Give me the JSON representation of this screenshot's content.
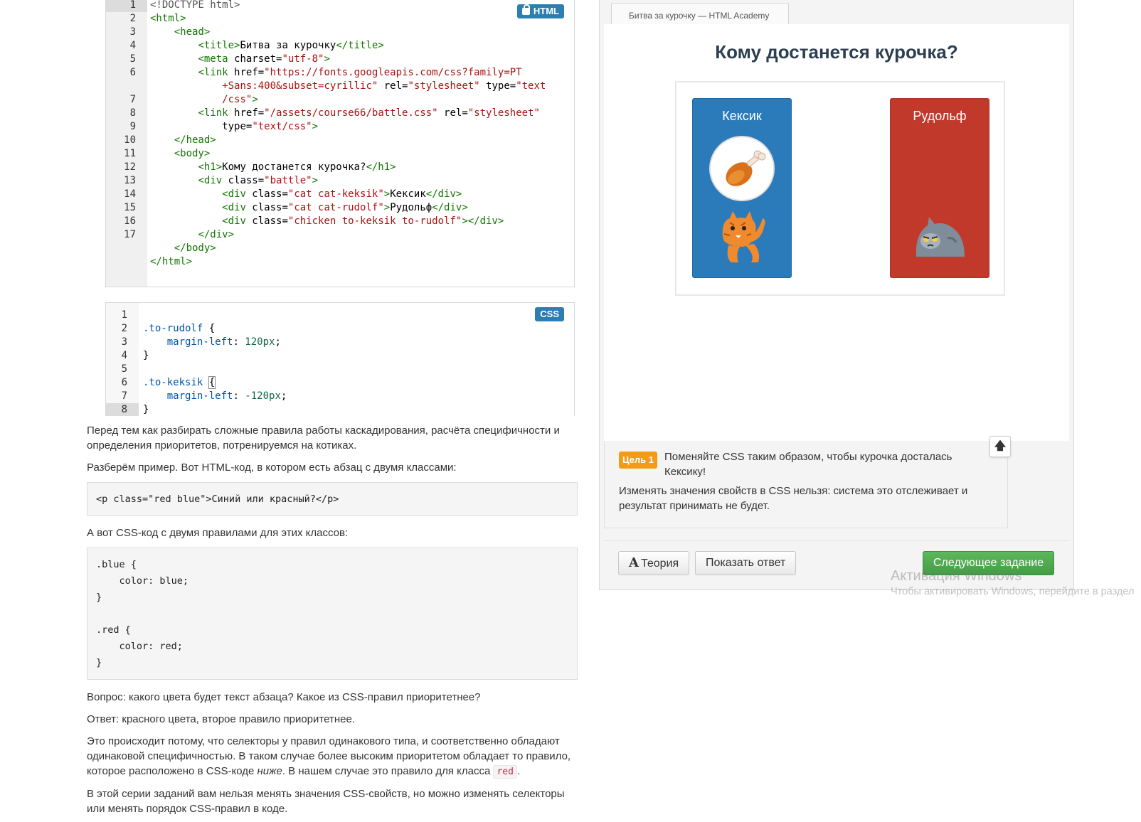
{
  "html_editor": {
    "badge": "HTML",
    "line_numbers": [
      "1",
      "2",
      "3",
      "4",
      "5",
      "6",
      "7",
      "8",
      "9",
      "10",
      "11",
      "12",
      "13",
      "14",
      "15",
      "16",
      "17"
    ],
    "lines": [
      [
        {
          "c": "t-meta",
          "t": "<!DOCTYPE html>"
        }
      ],
      [
        {
          "c": "t-tag",
          "t": "<html>"
        }
      ],
      [
        {
          "c": "t-txt",
          "t": "    "
        },
        {
          "c": "t-tag",
          "t": "<head>"
        }
      ],
      [
        {
          "c": "t-txt",
          "t": "        "
        },
        {
          "c": "t-tag",
          "t": "<title>"
        },
        {
          "c": "t-txt",
          "t": "Битва за курочку"
        },
        {
          "c": "t-tag",
          "t": "</title>"
        }
      ],
      [
        {
          "c": "t-txt",
          "t": "        "
        },
        {
          "c": "t-tag",
          "t": "<meta"
        },
        {
          "c": "t-attr",
          "t": " charset="
        },
        {
          "c": "t-str",
          "t": "\"utf-8\""
        },
        {
          "c": "t-tag",
          "t": ">"
        }
      ],
      [
        {
          "c": "t-txt",
          "t": "        "
        },
        {
          "c": "t-tag",
          "t": "<link"
        },
        {
          "c": "t-attr",
          "t": " href="
        },
        {
          "c": "t-str",
          "t": "\"https://fonts.googleapis.com/css?family=PT"
        }
      ],
      [
        {
          "c": "t-txt",
          "t": "            "
        },
        {
          "c": "t-str",
          "t": "+Sans:400&subset=cyrillic\""
        },
        {
          "c": "t-attr",
          "t": " rel="
        },
        {
          "c": "t-str",
          "t": "\"stylesheet\""
        },
        {
          "c": "t-attr",
          "t": " type="
        },
        {
          "c": "t-str",
          "t": "\"text"
        }
      ],
      [
        {
          "c": "t-txt",
          "t": "            "
        },
        {
          "c": "t-str",
          "t": "/css\""
        },
        {
          "c": "t-tag",
          "t": ">"
        }
      ],
      [
        {
          "c": "t-txt",
          "t": "        "
        },
        {
          "c": "t-tag",
          "t": "<link"
        },
        {
          "c": "t-attr",
          "t": " href="
        },
        {
          "c": "t-str",
          "t": "\"/assets/course66/battle.css\""
        },
        {
          "c": "t-attr",
          "t": " rel="
        },
        {
          "c": "t-str",
          "t": "\"stylesheet\""
        }
      ],
      [
        {
          "c": "t-txt",
          "t": "            "
        },
        {
          "c": "t-attr",
          "t": "type="
        },
        {
          "c": "t-str",
          "t": "\"text/css\""
        },
        {
          "c": "t-tag",
          "t": ">"
        }
      ],
      [
        {
          "c": "t-txt",
          "t": "    "
        },
        {
          "c": "t-tag",
          "t": "</head>"
        }
      ],
      [
        {
          "c": "t-txt",
          "t": "    "
        },
        {
          "c": "t-tag",
          "t": "<body>"
        }
      ],
      [
        {
          "c": "t-txt",
          "t": "        "
        },
        {
          "c": "t-tag",
          "t": "<h1>"
        },
        {
          "c": "t-txt",
          "t": "Кому достанется курочка?"
        },
        {
          "c": "t-tag",
          "t": "</h1>"
        }
      ],
      [
        {
          "c": "t-txt",
          "t": "        "
        },
        {
          "c": "t-tag",
          "t": "<div"
        },
        {
          "c": "t-attr",
          "t": " class="
        },
        {
          "c": "t-str",
          "t": "\"battle\""
        },
        {
          "c": "t-tag",
          "t": ">"
        }
      ],
      [
        {
          "c": "t-txt",
          "t": "            "
        },
        {
          "c": "t-tag",
          "t": "<div"
        },
        {
          "c": "t-attr",
          "t": " class="
        },
        {
          "c": "t-str",
          "t": "\"cat cat-keksik\""
        },
        {
          "c": "t-tag",
          "t": ">"
        },
        {
          "c": "t-txt",
          "t": "Кексик"
        },
        {
          "c": "t-tag",
          "t": "</div>"
        }
      ],
      [
        {
          "c": "t-txt",
          "t": "            "
        },
        {
          "c": "t-tag",
          "t": "<div"
        },
        {
          "c": "t-attr",
          "t": " class="
        },
        {
          "c": "t-str",
          "t": "\"cat cat-rudolf\""
        },
        {
          "c": "t-tag",
          "t": ">"
        },
        {
          "c": "t-txt",
          "t": "Рудольф"
        },
        {
          "c": "t-tag",
          "t": "</div>"
        }
      ],
      [
        {
          "c": "t-txt",
          "t": "            "
        },
        {
          "c": "t-tag",
          "t": "<div"
        },
        {
          "c": "t-attr",
          "t": " class="
        },
        {
          "c": "t-str",
          "t": "\"chicken to-keksik to-rudolf\""
        },
        {
          "c": "t-tag",
          "t": "></div>"
        }
      ],
      [
        {
          "c": "t-txt",
          "t": "        "
        },
        {
          "c": "t-tag",
          "t": "</div>"
        }
      ],
      [
        {
          "c": "t-txt",
          "t": "    "
        },
        {
          "c": "t-tag",
          "t": "</body>"
        }
      ],
      [
        {
          "c": "t-tag",
          "t": "</html>"
        }
      ]
    ],
    "line_number_rows": [
      0,
      1,
      2,
      3,
      4,
      5,
      7,
      8,
      9,
      10,
      11,
      12,
      13,
      14,
      15,
      16,
      17,
      18,
      19
    ],
    "active_line": "1"
  },
  "css_editor": {
    "badge": "CSS",
    "line_numbers": [
      "1",
      "2",
      "3",
      "4",
      "5",
      "6",
      "7",
      "8"
    ],
    "active_line": "8",
    "lines": [
      [],
      [
        {
          "c": "t-sel",
          "t": ".to-rudolf"
        },
        {
          "c": "t-txt",
          "t": " {"
        }
      ],
      [
        {
          "c": "t-txt",
          "t": "    "
        },
        {
          "c": "t-prop",
          "t": "margin-left"
        },
        {
          "c": "t-txt",
          "t": ": "
        },
        {
          "c": "t-num",
          "t": "120px"
        },
        {
          "c": "t-txt",
          "t": ";"
        }
      ],
      [
        {
          "c": "t-txt",
          "t": "}"
        }
      ],
      [],
      [
        {
          "c": "t-sel",
          "t": ".to-keksik"
        },
        {
          "c": "t-txt",
          "t": " "
        },
        {
          "c": "cursor-box",
          "t": "{"
        }
      ],
      [
        {
          "c": "t-txt",
          "t": "    "
        },
        {
          "c": "t-prop",
          "t": "margin-left"
        },
        {
          "c": "t-txt",
          "t": ": "
        },
        {
          "c": "t-num",
          "t": "-120px"
        },
        {
          "c": "t-txt",
          "t": ";"
        }
      ],
      [
        {
          "c": "t-txt",
          "t": "}"
        }
      ]
    ]
  },
  "article": {
    "p1": "Перед тем как разбирать сложные правила работы каскадирования, расчёта специфичности и определения приоритетов, потренируемся на котиках.",
    "p2": "Разберём пример. Вот HTML-код, в котором есть абзац с двумя классами:",
    "code1": "<p class=\"red blue\">Синий или красный?</p>",
    "p3": "А вот CSS-код с двумя правилами для этих классов:",
    "code2": ".blue {\n    color: blue;\n}\n\n.red {\n    color: red;\n}",
    "p4": "Вопрос: какого цвета будет текст абзаца? Какое из CSS-правил приоритетнее?",
    "p5": "Ответ: красного цвета, второе правило приоритетнее.",
    "p6_a": "Это происходит потому, что селекторы у правил одинакового типа, и соответственно обладают одинаковой специфичностью. В таком случае более высоким приоритетом обладает то правило, которое расположено в CSS-коде ",
    "p6_em": "ниже",
    "p6_b": ". В нашем случае это правило для класса ",
    "p6_code": "red",
    "p6_c": ".",
    "p7": "В этой серии заданий вам нельзя менять значения CSS-свойств, но можно изменять селекторы или менять порядок CSS-правил в коде."
  },
  "preview": {
    "tab_title": "Битва за курочку — HTML Academy",
    "heading": "Кому достанется курочка?",
    "cat_left": "Кексик",
    "cat_right": "Рудольф",
    "colors": {
      "keksik": "#2b7bbb",
      "rudolf": "#c0392b",
      "next_button": "#5cb85c",
      "goal_badge": "#f39c12"
    }
  },
  "task": {
    "goal_badge": "Цель 1",
    "goal_text": "Поменяйте CSS таким образом, чтобы курочка досталась Кексику!",
    "note": "Изменять значения свойств в CSS нельзя: система это отслеживает и результат принимать не будет.",
    "up_icon": "arrow-up-icon"
  },
  "buttons": {
    "theory_icon": "A",
    "theory": "Теория",
    "show_answer": "Показать ответ",
    "next": "Следующее задание"
  },
  "watermark": {
    "line1": "Активация Windows",
    "line2": "Чтобы активировать Windows, перейдите в раздел"
  }
}
